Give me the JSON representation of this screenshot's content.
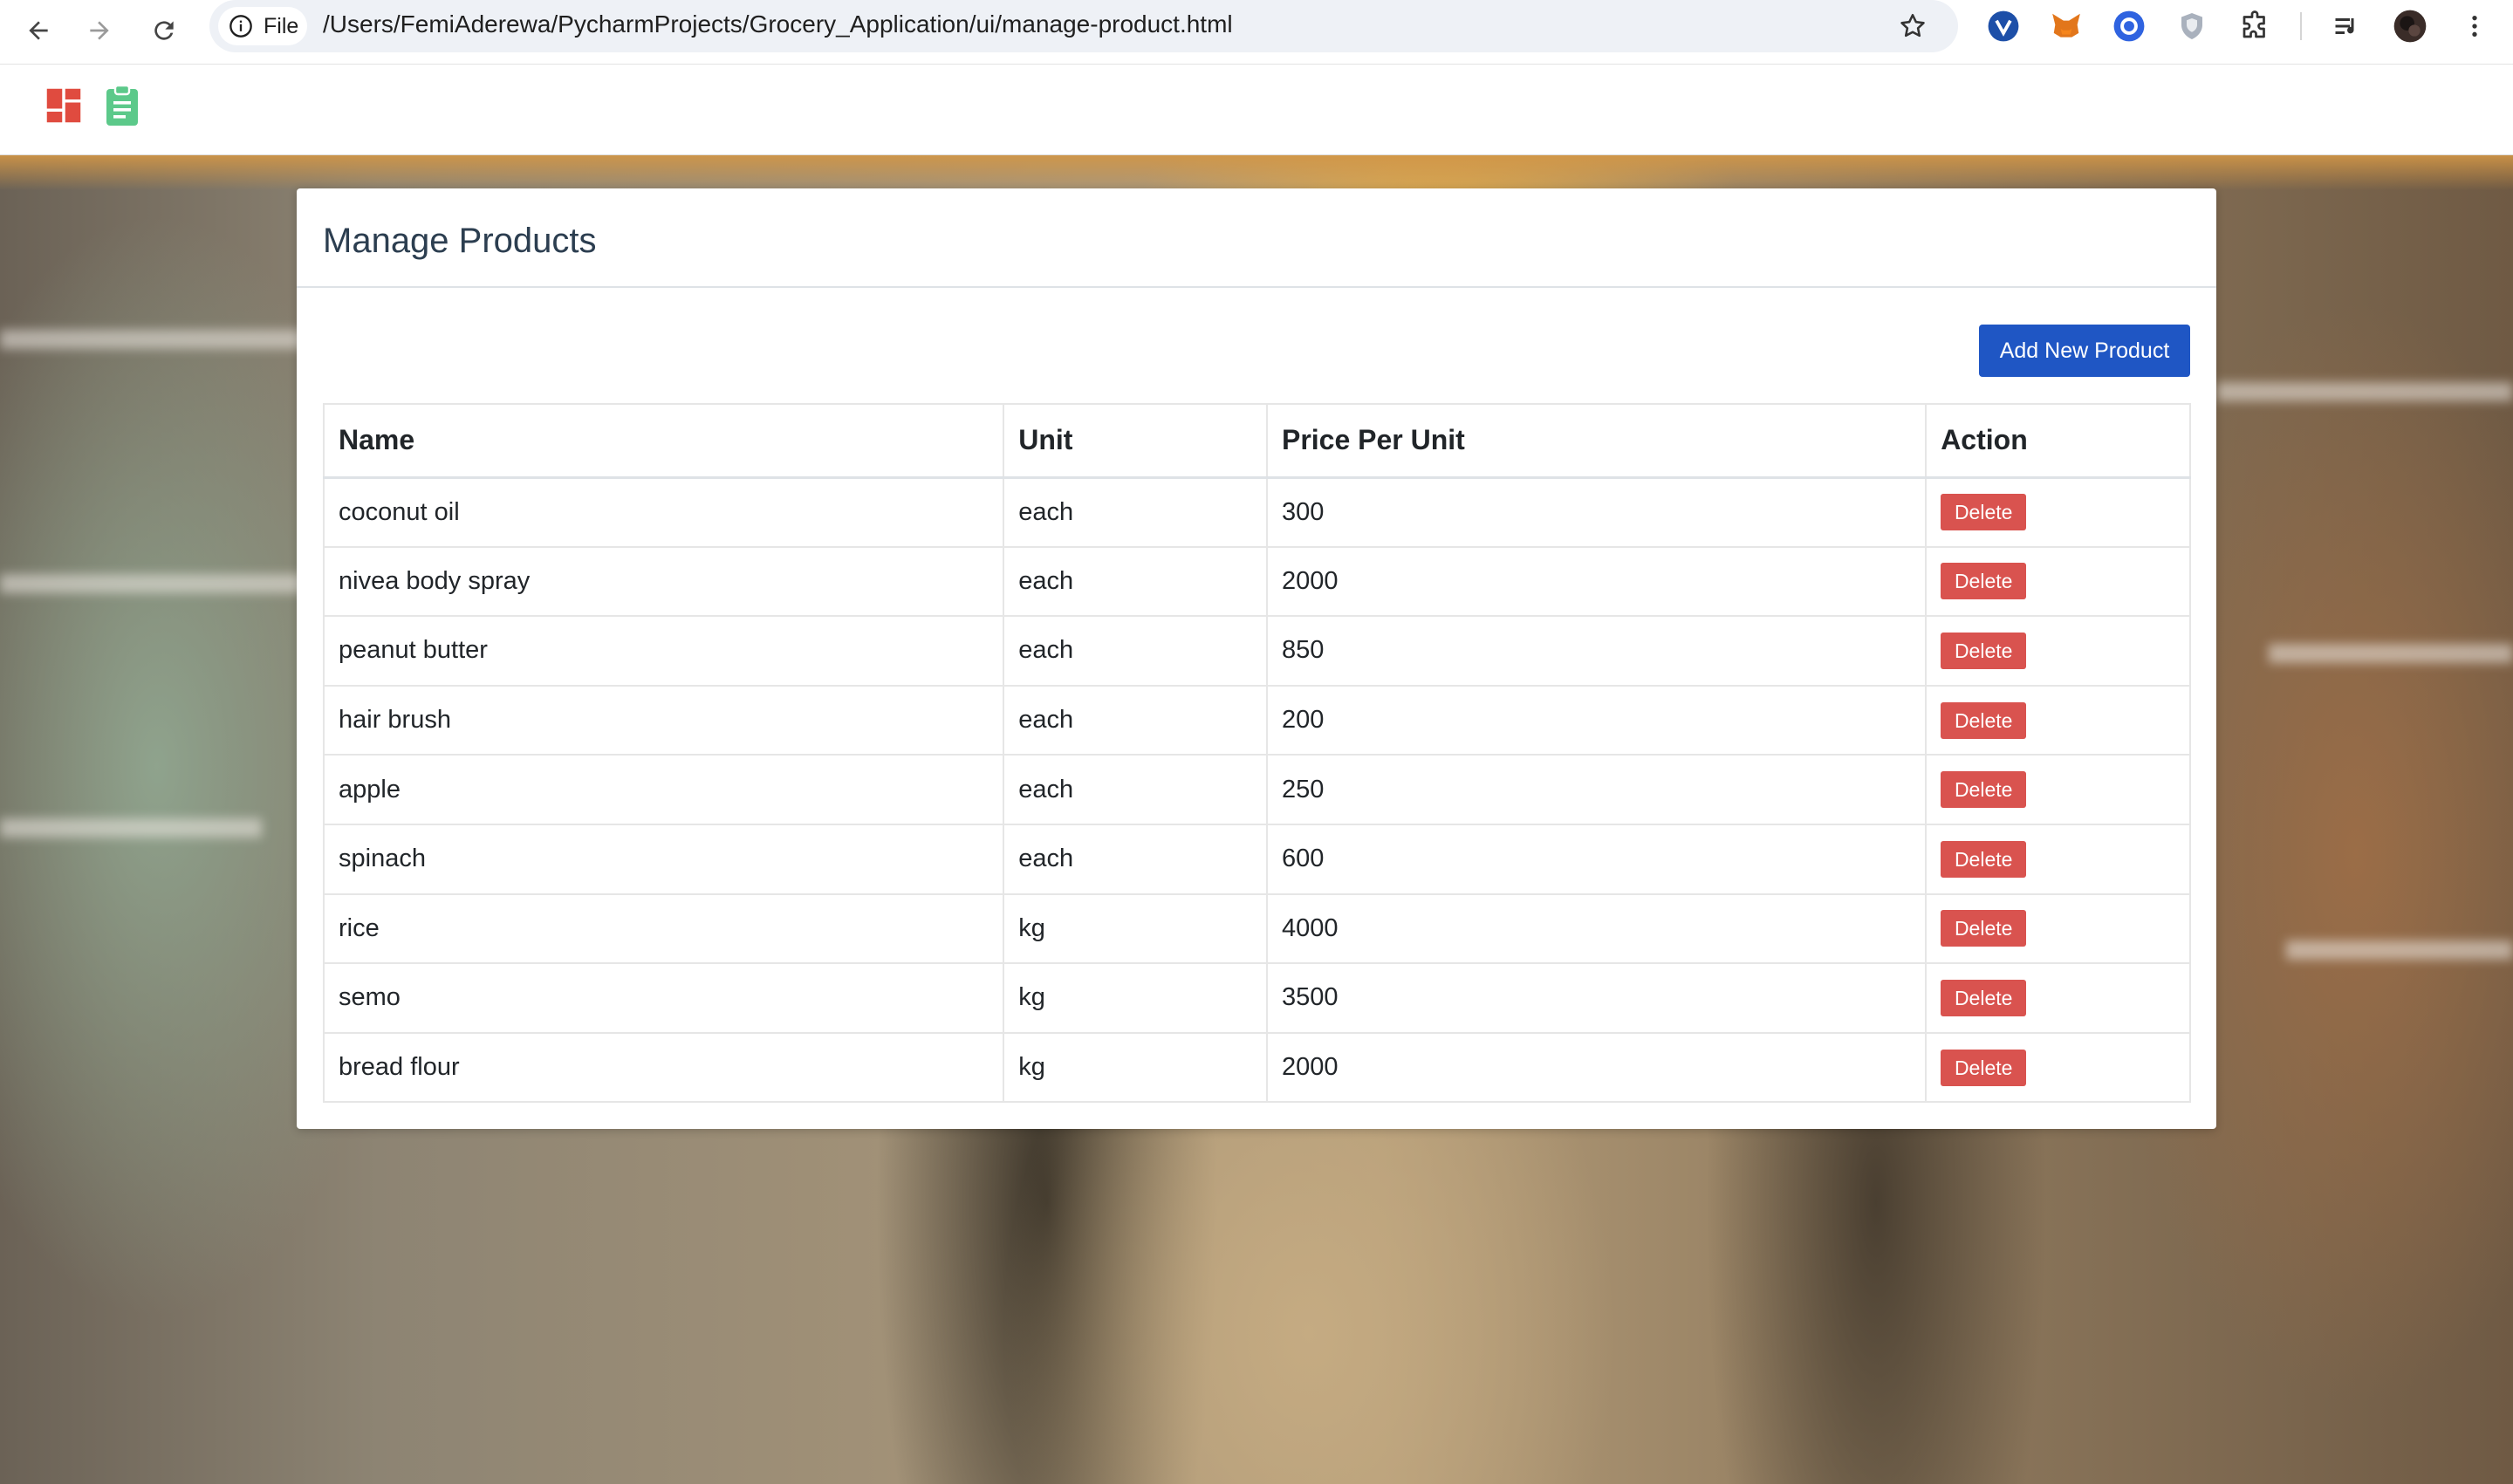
{
  "browser": {
    "site_info_label": "File",
    "url": "/Users/FemiAderewa/PycharmProjects/Grocery_Application/ui/manage-product.html",
    "extensions": [
      "vimeo-extension-icon",
      "metamask-fox-icon",
      "blue-circle-extension-icon",
      "shield-extension-icon",
      "puzzle-extensions-icon"
    ]
  },
  "appbar": {
    "icons": [
      "dashboard-icon",
      "clipboard-icon"
    ],
    "colors": {
      "dashboard": "#e04b3f",
      "clipboard": "#5cc98a"
    }
  },
  "page": {
    "title": "Manage Products",
    "add_button_label": "Add New Product",
    "table": {
      "headers": [
        "Name",
        "Unit",
        "Price Per Unit",
        "Action"
      ],
      "rows": [
        {
          "name": "coconut oil",
          "unit": "each",
          "price": "300",
          "action": "Delete"
        },
        {
          "name": "nivea body spray",
          "unit": "each",
          "price": "2000",
          "action": "Delete"
        },
        {
          "name": "peanut butter",
          "unit": "each",
          "price": "850",
          "action": "Delete"
        },
        {
          "name": "hair brush",
          "unit": "each",
          "price": "200",
          "action": "Delete"
        },
        {
          "name": "apple",
          "unit": "each",
          "price": "250",
          "action": "Delete"
        },
        {
          "name": "spinach",
          "unit": "each",
          "price": "600",
          "action": "Delete"
        },
        {
          "name": "rice",
          "unit": "kg",
          "price": "4000",
          "action": "Delete"
        },
        {
          "name": "semo",
          "unit": "kg",
          "price": "3500",
          "action": "Delete"
        },
        {
          "name": "bread flour",
          "unit": "kg",
          "price": "2000",
          "action": "Delete"
        }
      ]
    },
    "colors": {
      "primary_button": "#1f56c4",
      "danger_button": "#d9534f",
      "title_text": "#2c3e50"
    }
  }
}
